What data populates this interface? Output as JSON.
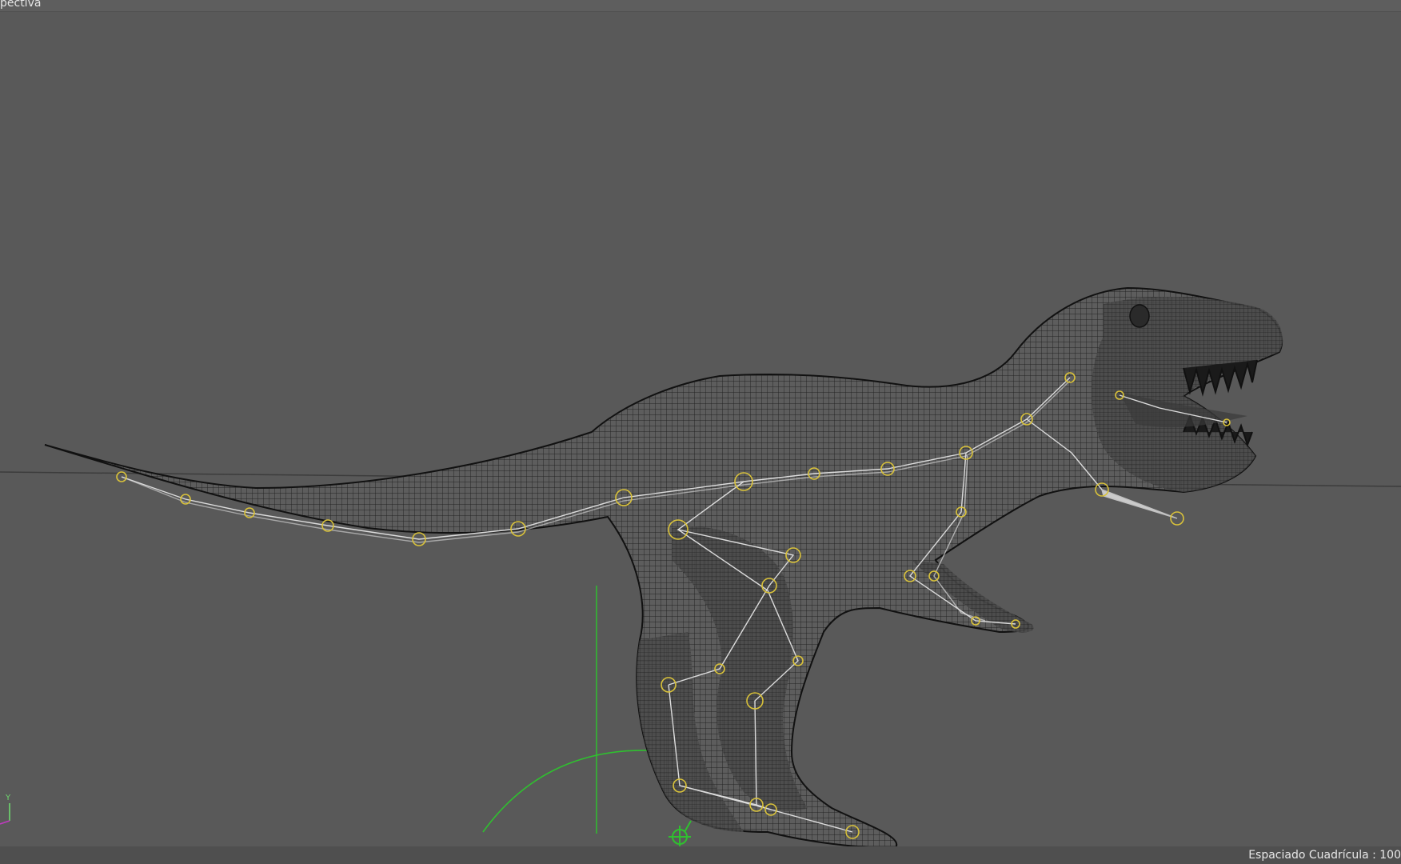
{
  "viewport": {
    "view_name": "pectiva",
    "grid_spacing_label": "Espaciado Cuadrícula : 100"
  },
  "axis_gizmo": {
    "y_label": "Y"
  },
  "colors": {
    "background": "#595959",
    "mesh_wire": "#1a1a1a",
    "bone": "#dcdcdc",
    "joint": "#d9c23a",
    "grid_axis": "#2fc02f",
    "horizon": "#3a3a3a"
  },
  "icons": {
    "root_control": "root-control-icon",
    "axis": "axis-gizmo-icon"
  }
}
